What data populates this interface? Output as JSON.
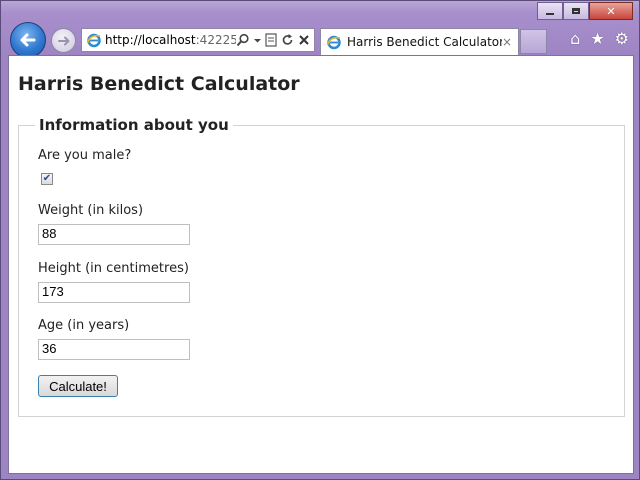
{
  "browser": {
    "url_host": "http://localhost",
    "url_rest": ":42225/",
    "tab_title": "Harris Benedict Calculator",
    "tab_close": "×",
    "caption_close": "✕"
  },
  "page": {
    "title": "Harris Benedict Calculator",
    "fieldset_legend": "Information about you",
    "male_label": "Are you male?",
    "male_checked": true,
    "weight_label": "Weight (in kilos)",
    "weight_value": "88",
    "height_label": "Height (in centimetres)",
    "height_value": "173",
    "age_label": "Age (in years)",
    "age_value": "36",
    "calculate_label": "Calculate!"
  },
  "colors": {
    "frame": "#a88fcc",
    "back_button": "#2f78d0",
    "button_border": "#3c7fb1"
  }
}
